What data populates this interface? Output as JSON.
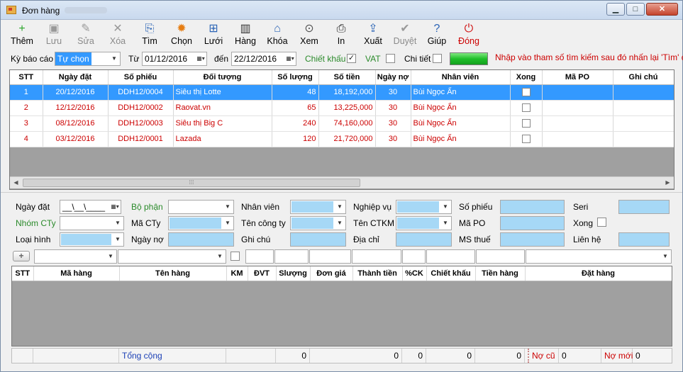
{
  "window": {
    "title": "Đơn hàng",
    "controls": {
      "minimize": "▁",
      "maximize": "□",
      "close": "✕"
    }
  },
  "toolbar": [
    {
      "label": "Thêm",
      "icon": "add-icon",
      "glyph": "+",
      "enabled": true
    },
    {
      "label": "Lưu",
      "icon": "save-icon",
      "glyph": "▣",
      "enabled": false
    },
    {
      "label": "Sửa",
      "icon": "edit-icon",
      "glyph": "✎",
      "enabled": false
    },
    {
      "label": "Xóa",
      "icon": "delete-icon",
      "glyph": "✕",
      "enabled": false
    },
    {
      "label": "Tìm",
      "icon": "find-icon",
      "glyph": "⎘",
      "enabled": true
    },
    {
      "label": "Chọn",
      "icon": "gear-icon",
      "glyph": "✹",
      "enabled": true
    },
    {
      "label": "Lưới",
      "icon": "grid-icon",
      "glyph": "⊞",
      "enabled": true
    },
    {
      "label": "Hàng",
      "icon": "books-icon",
      "glyph": "▥",
      "enabled": true
    },
    {
      "label": "Khóa",
      "icon": "lock-icon",
      "glyph": "⌂",
      "enabled": true
    },
    {
      "label": "Xem",
      "icon": "preview-icon",
      "glyph": "⊙",
      "enabled": true
    },
    {
      "label": "In",
      "icon": "printer-icon",
      "glyph": "⎙",
      "enabled": true
    },
    {
      "label": "Xuất",
      "icon": "export-icon",
      "glyph": "⇪",
      "enabled": true
    },
    {
      "label": "Duyệt",
      "icon": "approve-icon",
      "glyph": "✔",
      "enabled": false
    },
    {
      "label": "Giúp",
      "icon": "help-icon",
      "glyph": "?",
      "enabled": true
    },
    {
      "label": "Đóng",
      "icon": "power-icon",
      "glyph": "⏻",
      "enabled": true
    }
  ],
  "filter": {
    "period_label": "Kỳ báo cáo",
    "period_value": "Tự chọn",
    "from_label": "Từ",
    "from_value": "01/12/2016",
    "to_label": "đến",
    "to_value": "22/12/2016",
    "discount_label": "Chiết khấu",
    "discount_checked": true,
    "vat_label": "VAT",
    "vat_checked": false,
    "detail_label": "Chi tiết",
    "detail_checked": false,
    "hint": "Nhập vào tham số tìm kiếm sau đó nhấn lại 'Tìm' để"
  },
  "orders": {
    "columns": [
      "STT",
      "Ngày đặt",
      "Số phiếu",
      "Đối tượng",
      "Số lượng",
      "Số tiền",
      "Ngày nợ",
      "Nhân viên",
      "Xong",
      "Mã PO",
      "Ghi chú"
    ],
    "rows": [
      {
        "stt": "1",
        "date": "20/12/2016",
        "no": "DDH12/0004",
        "customer": "Siêu thị Lotte",
        "qty": "48",
        "amount": "18,192,000",
        "debt_days": "30",
        "staff": "Bùi Ngọc Ẩn",
        "selected": true
      },
      {
        "stt": "2",
        "date": "12/12/2016",
        "no": "DDH12/0002",
        "customer": "Raovat.vn",
        "qty": "65",
        "amount": "13,225,000",
        "debt_days": "30",
        "staff": "Bùi Ngọc Ẩn",
        "selected": false
      },
      {
        "stt": "3",
        "date": "08/12/2016",
        "no": "DDH12/0003",
        "customer": "Siêu thị Big C",
        "qty": "240",
        "amount": "74,160,000",
        "debt_days": "30",
        "staff": "Bùi Ngọc Ẩn",
        "selected": false
      },
      {
        "stt": "4",
        "date": "03/12/2016",
        "no": "DDH12/0001",
        "customer": "Lazada",
        "qty": "120",
        "amount": "21,720,000",
        "debt_days": "30",
        "staff": "Bùi Ngọc Ẩn",
        "selected": false
      }
    ]
  },
  "form": {
    "order_date_label": "Ngày đặt",
    "order_date_value": "__\\__\\____",
    "department_label": "Bộ phận",
    "staff_label": "Nhân viên",
    "business_label": "Nghiệp vụ",
    "voucher_no_label": "Số phiếu",
    "serial_label": "Seri",
    "company_group_label": "Nhóm CTy",
    "company_code_label": "Mã CTy",
    "company_name_label": "Tên công ty",
    "promo_name_label": "Tên CTKM",
    "po_code_label": "Mã PO",
    "done_label": "Xong",
    "type_label": "Loại hình",
    "debt_date_label": "Ngày nợ",
    "note_label": "Ghi chú",
    "address_label": "Địa chỉ",
    "tax_code_label": "MS thuế",
    "contact_label": "Liên hệ"
  },
  "details": {
    "columns": [
      "STT",
      "Mã hàng",
      "Tên hàng",
      "KM",
      "ĐVT",
      "Slượng",
      "Đơn giá",
      "Thành tiền",
      "%CK",
      "Chiết khấu",
      "Tiền hàng",
      "Đặt hàng"
    ]
  },
  "totals": {
    "label": "Tổng cộng",
    "qty": "0",
    "amount": "0",
    "discount_pct": "0",
    "discount": "0",
    "goods": "0",
    "old_debt_label": "Nợ cũ",
    "old_debt": "0",
    "new_debt_label": "Nợ mới",
    "new_debt": "0"
  },
  "colors": {
    "selection": "#3399ff",
    "row_text": "#cc0000",
    "input_blue": "#a6d8f6",
    "progress_green": "#1fbf2a"
  }
}
